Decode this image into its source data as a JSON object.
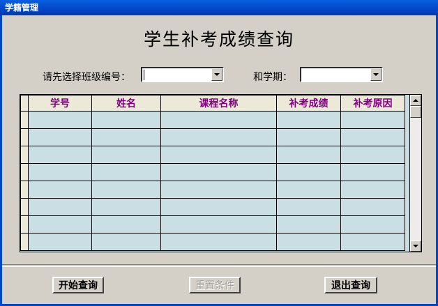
{
  "window": {
    "title": "学籍管理"
  },
  "page_title": "学生补考成绩查询",
  "filters": {
    "class_label": "请先选择班级编号：",
    "class_value": "",
    "term_label": "和学期：",
    "term_value": ""
  },
  "grid": {
    "columns": [
      "学号",
      "姓名",
      "课程名称",
      "补考成绩",
      "补考原因"
    ],
    "rows": [
      [
        "",
        "",
        "",
        "",
        ""
      ],
      [
        "",
        "",
        "",
        "",
        ""
      ],
      [
        "",
        "",
        "",
        "",
        ""
      ],
      [
        "",
        "",
        "",
        "",
        ""
      ],
      [
        "",
        "",
        "",
        "",
        ""
      ],
      [
        "",
        "",
        "",
        "",
        ""
      ],
      [
        "",
        "",
        "",
        "",
        ""
      ],
      [
        "",
        "",
        "",
        "",
        ""
      ]
    ]
  },
  "buttons": {
    "start": "开始查询",
    "reset": "重置条件",
    "exit": "退出查询"
  },
  "colors": {
    "header_text": "#800080",
    "cell_bg": "#c9dfe3",
    "title_bar": "#0046c8"
  }
}
